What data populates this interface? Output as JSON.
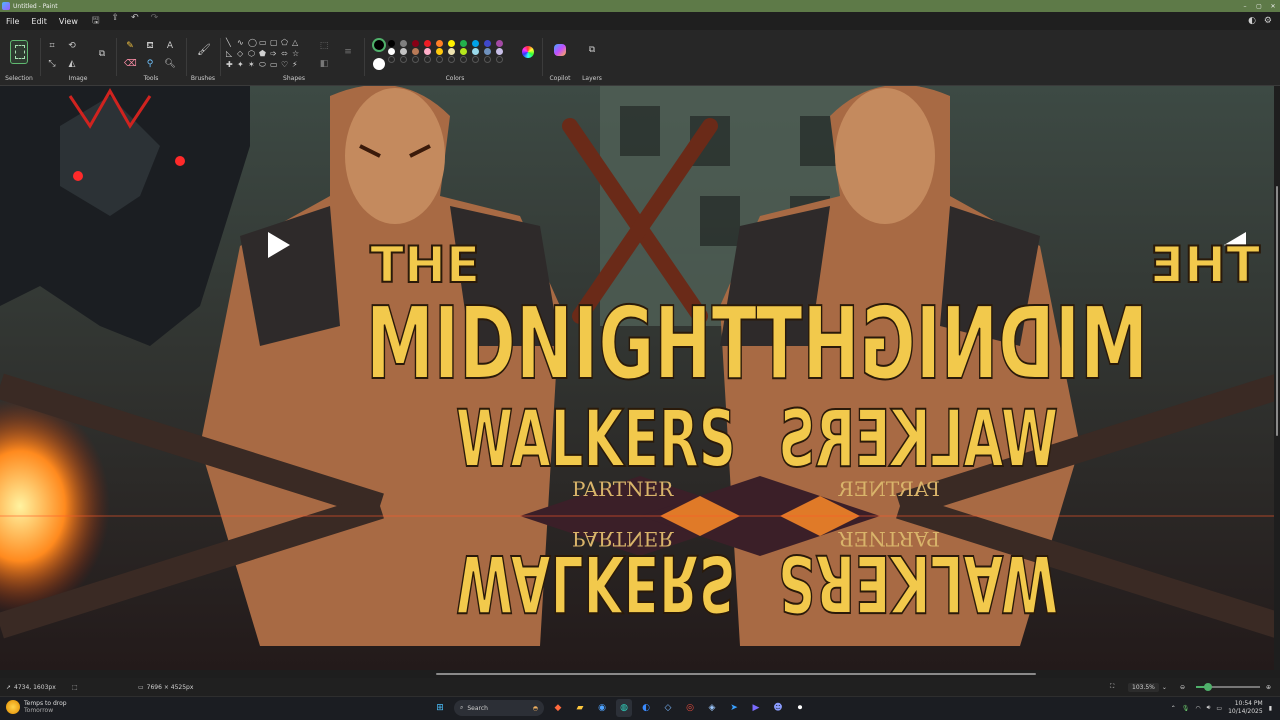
{
  "window": {
    "title": "Untitled - Paint"
  },
  "menu": {
    "file": "File",
    "edit": "Edit",
    "view": "View"
  },
  "ribbon": {
    "groups": {
      "selection": "Selection",
      "image": "Image",
      "tools": "Tools",
      "brushes": "Brushes",
      "shapes": "Shapes",
      "colors": "Colors",
      "copilot": "Copilot",
      "layers": "Layers"
    },
    "shape_glyphs": [
      "╲",
      "∿",
      "◯",
      "▭",
      "▢",
      "⬠",
      "△",
      "◺",
      "◇",
      "⬡",
      "⬟",
      "➩",
      "⬄",
      "☆",
      "✚",
      "✦",
      "✶",
      "⬭",
      "▭",
      "♡",
      "⚡"
    ],
    "palette_colors": [
      "#000000",
      "#7f7f7f",
      "#880015",
      "#ed1c24",
      "#ff7f27",
      "#fff200",
      "#22b14c",
      "#00a2e8",
      "#3f48cc",
      "#a349a4",
      "#ffffff",
      "#c3c3c3",
      "#b97a57",
      "#ffaec9",
      "#ffc90e",
      "#efe4b0",
      "#b5e61d",
      "#99d9ea",
      "#7092be",
      "#c8bfe7"
    ],
    "primary_color": "#000000",
    "secondary_color": "#ffffff"
  },
  "canvas_text": {
    "the_left": "THE",
    "the_right": "THE",
    "title_line": "MIDNIGHT",
    "walkers": "WALKERS",
    "partner": "PARTNER"
  },
  "status": {
    "cursor_pos": "4734, 1603px",
    "canvas_size": "7696 × 4525px",
    "zoom": "103.5%",
    "zoom_fraction": 0.18
  },
  "taskbar": {
    "weather_title": "Temps to drop",
    "weather_sub": "Tomorrow",
    "search_placeholder": "Search",
    "time": "10:54 PM",
    "date": "10/14/2025"
  }
}
